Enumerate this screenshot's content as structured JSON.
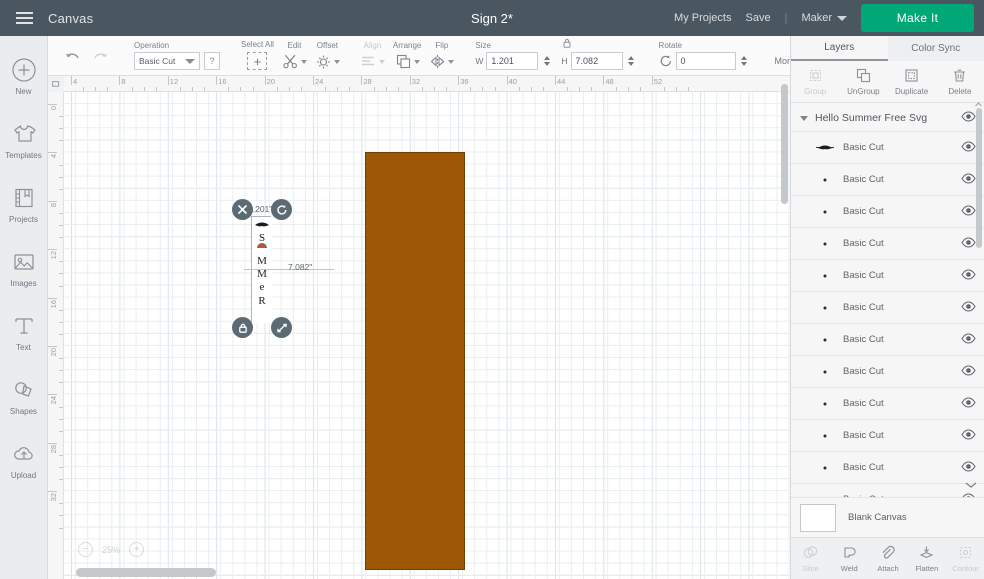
{
  "topbar": {
    "menu_icon": "hamburger-icon",
    "canvas_label": "Canvas",
    "project_title": "Sign 2*",
    "my_projects": "My Projects",
    "save": "Save",
    "separator": "|",
    "machine": "Maker",
    "make_it": "Make It",
    "accent_green": "#00a877",
    "bar_color": "#4a5760"
  },
  "left_rail": {
    "items": [
      {
        "label": "New",
        "icon": "plus-circle-icon"
      },
      {
        "label": "Templates",
        "icon": "tshirt-icon"
      },
      {
        "label": "Projects",
        "icon": "book-icon"
      },
      {
        "label": "Images",
        "icon": "photo-icon"
      },
      {
        "label": "Text",
        "icon": "text-t-icon"
      },
      {
        "label": "Shapes",
        "icon": "shapes-icon"
      },
      {
        "label": "Upload",
        "icon": "upload-cloud-icon"
      }
    ]
  },
  "toolbar": {
    "undo": "undo-icon",
    "redo": "redo-icon",
    "operation_label": "Operation",
    "operation_value": "Basic Cut",
    "operation_help": "?",
    "select_all_label": "Select All",
    "edit_label": "Edit",
    "offset_label": "Offset",
    "align_label": "Align",
    "arrange_label": "Arrange",
    "flip_label": "Flip",
    "size_label": "Size",
    "width_label": "W",
    "width_value": "1.201",
    "height_label": "H",
    "height_value": "7.082",
    "lock_icon": "lock-aspect-icon",
    "rotate_label": "Rotate",
    "rotate_value": "0",
    "more_label": "More"
  },
  "canvas": {
    "ruler_h_labels": [
      "4",
      "8",
      "12",
      "16",
      "20",
      "24",
      "28",
      "32",
      "36",
      "40",
      "44",
      "48",
      "52"
    ],
    "ruler_v_labels": [
      "0",
      "4",
      "8",
      "12",
      "16",
      "20",
      "24",
      "28",
      "32"
    ],
    "zoom_percent": "25%",
    "zoom_out": "−",
    "zoom_in": "+",
    "mat_color": "#9d5705",
    "selection": {
      "width_dim": "1.201\"",
      "height_dim": "7.082\"",
      "delete_handle": "delete-handle-icon",
      "rotate_handle": "rotate-handle-icon",
      "lock_handle": "lock-handle-icon",
      "resize_handle": "resize-handle-icon",
      "object_text": "SUMMER"
    }
  },
  "right_panel": {
    "tabs": [
      {
        "label": "Layers",
        "active": true
      },
      {
        "label": "Color Sync",
        "active": false
      }
    ],
    "actions": [
      {
        "label": "Group",
        "icon": "group-icon",
        "enabled": false
      },
      {
        "label": "UnGroup",
        "icon": "ungroup-icon",
        "enabled": true
      },
      {
        "label": "Duplicate",
        "icon": "duplicate-icon",
        "enabled": true
      },
      {
        "label": "Delete",
        "icon": "trash-icon",
        "enabled": true
      }
    ],
    "group_layer": {
      "name": "Hello Summer Free Svg",
      "visible": true
    },
    "layers": [
      {
        "name": "Basic Cut",
        "visible": true,
        "thumb": "watermelon-thumb"
      },
      {
        "name": "Basic Cut",
        "visible": true,
        "thumb": "dot-thumb"
      },
      {
        "name": "Basic Cut",
        "visible": true,
        "thumb": "dot-thumb"
      },
      {
        "name": "Basic Cut",
        "visible": true,
        "thumb": "dot-thumb"
      },
      {
        "name": "Basic Cut",
        "visible": true,
        "thumb": "dot-thumb"
      },
      {
        "name": "Basic Cut",
        "visible": true,
        "thumb": "dot-thumb"
      },
      {
        "name": "Basic Cut",
        "visible": true,
        "thumb": "dot-thumb"
      },
      {
        "name": "Basic Cut",
        "visible": true,
        "thumb": "dot-thumb"
      },
      {
        "name": "Basic Cut",
        "visible": true,
        "thumb": "dot-thumb"
      },
      {
        "name": "Basic Cut",
        "visible": true,
        "thumb": "dot-thumb"
      },
      {
        "name": "Basic Cut",
        "visible": true,
        "thumb": "dot-thumb"
      },
      {
        "name": "Basic Cut",
        "visible": true,
        "thumb": "dot-thumb"
      }
    ],
    "blank_canvas": {
      "label": "Blank Canvas",
      "color": "#ffffff"
    },
    "bottom_actions": [
      {
        "label": "Slice",
        "icon": "slice-icon",
        "enabled": false
      },
      {
        "label": "Weld",
        "icon": "weld-icon",
        "enabled": true
      },
      {
        "label": "Attach",
        "icon": "paperclip-icon",
        "enabled": true
      },
      {
        "label": "Flatten",
        "icon": "flatten-icon",
        "enabled": true
      },
      {
        "label": "Contour",
        "icon": "contour-icon",
        "enabled": false
      }
    ]
  }
}
